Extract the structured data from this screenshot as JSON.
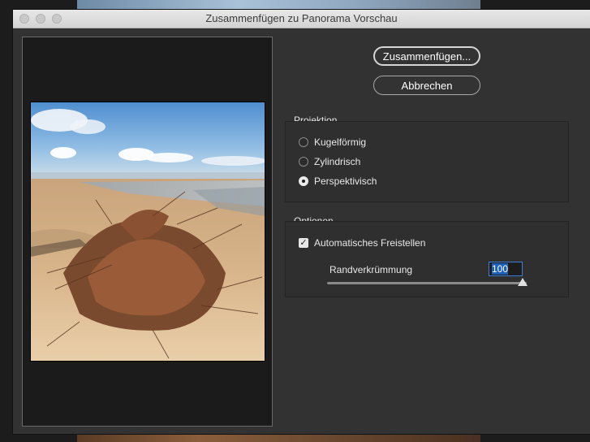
{
  "window": {
    "title": "Zusammenfügen zu Panorama Vorschau"
  },
  "buttons": {
    "merge_label": "Zusammenfügen...",
    "cancel_label": "Abbrechen"
  },
  "projection": {
    "title": "Projektion",
    "options": [
      {
        "label": "Kugelförmig",
        "selected": false
      },
      {
        "label": "Zylindrisch",
        "selected": false
      },
      {
        "label": "Perspektivisch",
        "selected": true
      }
    ]
  },
  "options": {
    "title": "Optionen",
    "auto_crop": {
      "label": "Automatisches Freistellen",
      "checked": true
    },
    "boundary_warp": {
      "label": "Randverkrümmung",
      "value": "100",
      "fraction": 1.0
    }
  },
  "preview": {
    "icon": "panorama-preview-image"
  }
}
